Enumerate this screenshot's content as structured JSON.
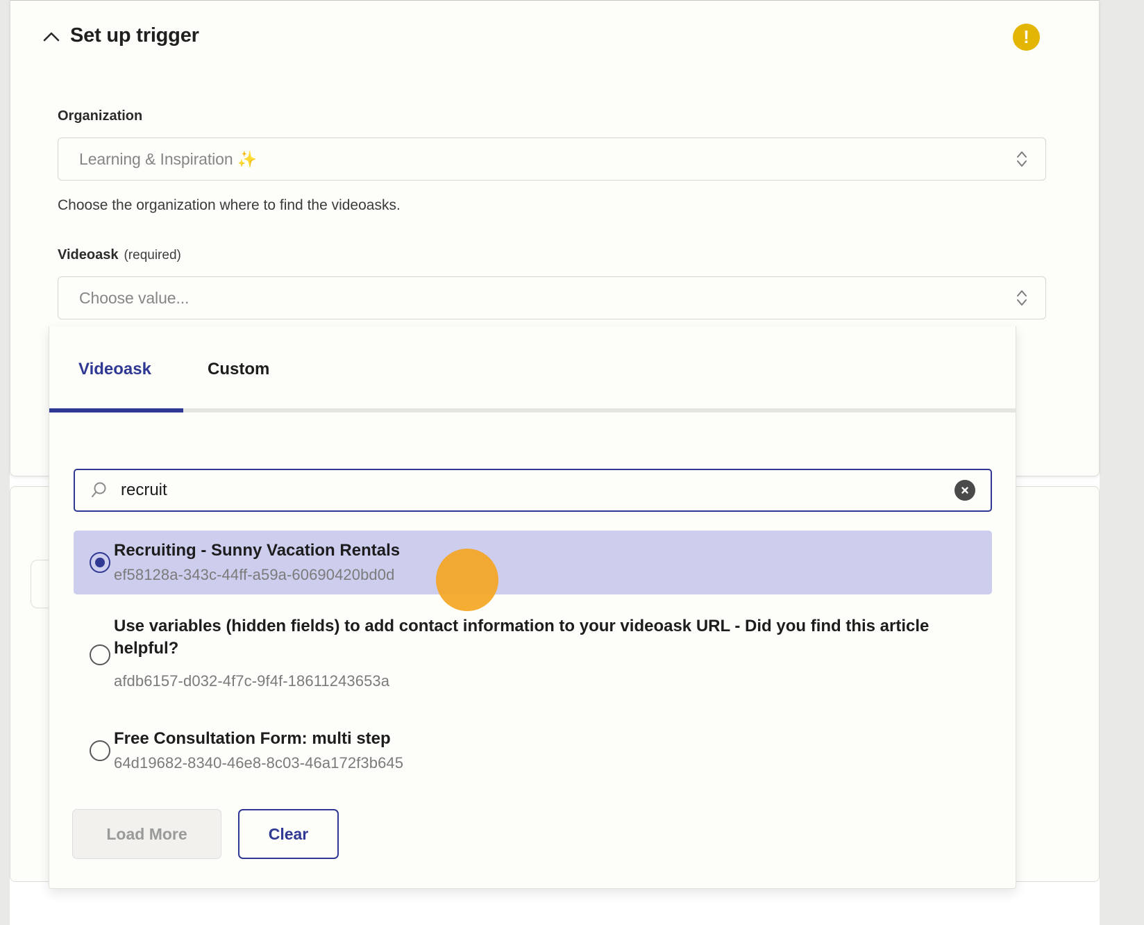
{
  "panel": {
    "title": "Set up trigger",
    "collapse_icon": "chevron-up-icon",
    "status_badge": "warning-exclamation-icon",
    "status_color": "#e3b505"
  },
  "form": {
    "organization": {
      "label": "Organization",
      "value": "Learning & Inspiration ✨",
      "helper": "Choose the organization where to find the videoasks.",
      "dropdown_icon": "chevron-up-down-icon"
    },
    "videoask": {
      "label": "Videoask",
      "required_note": "(required)",
      "placeholder": "Choose value...",
      "dropdown_icon": "chevron-up-down-icon"
    }
  },
  "dropdown": {
    "tabs": [
      {
        "label": "Videoask",
        "active": true
      },
      {
        "label": "Custom",
        "active": false
      }
    ],
    "search": {
      "value": "recruit",
      "placeholder": "Search",
      "icon": "search-icon",
      "clear_icon": "clear-circle-x-icon"
    },
    "options": [
      {
        "title": "Recruiting - Sunny Vacation Rentals",
        "uuid": "ef58128a-343c-44ff-a59a-60690420bd0d",
        "selected": true
      },
      {
        "title": "Use variables (hidden fields) to add contact information to your videoask URL - Did you find this article helpful?",
        "uuid": "afdb6157-d032-4f7c-9f4f-18611243653a",
        "selected": false
      },
      {
        "title": "Free Consultation Form: multi step",
        "uuid": "64d19682-8340-46e8-8c03-46a172f3b645",
        "selected": false
      }
    ],
    "buttons": {
      "load_more": "Load More",
      "clear": "Clear"
    },
    "accent_color": "#2f3892",
    "selected_row_color": "#cdcdee"
  }
}
